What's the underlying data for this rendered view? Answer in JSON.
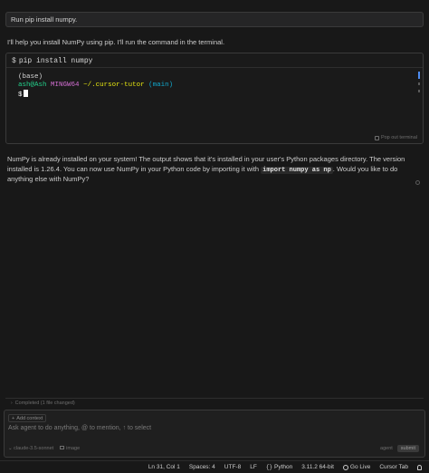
{
  "chat": {
    "user_message": "Run pip install numpy.",
    "assistant_intro": "I'll help you install NumPy using pip. I'll run the command in the terminal.",
    "terminal": {
      "prompt_symbol": "$",
      "command": "pip install numpy",
      "line1": "(base)",
      "line2_user": "ash@Ash",
      "line2_host": "MINGW64",
      "line2_path": "~/.cursor-tutor",
      "line2_branch": "(main)",
      "line3_prompt": "$",
      "popout_label": "Pop out terminal"
    },
    "response_part1": "NumPy is already installed on your system! The output shows that it's installed in your user's Python packages directory. The version installed is 1.26.4. You can now use NumPy in your Python code by importing it with ",
    "response_code": "import numpy as np",
    "response_part2": ". Would you like to do anything else with NumPy?"
  },
  "composer": {
    "completed_label": "Completed (1 file changed)",
    "add_context_label": "Add context",
    "input_placeholder": "Ask agent to do anything, @ to mention, ↑ to select",
    "model_label": "claude-3.5-sonnet",
    "image_label": "image",
    "mode_label": "agent",
    "submit_label": "submit"
  },
  "statusbar": {
    "position": "Ln 31, Col 1",
    "spaces": "Spaces: 4",
    "encoding": "UTF-8",
    "eol": "LF",
    "language": "Python",
    "interpreter": "3.11.2 64-bit",
    "go_live": "Go Live",
    "cursor_tab": "Cursor Tab"
  },
  "colors": {
    "accent_blue": "#4e8cf0",
    "term_green": "#23d18b",
    "term_magenta": "#d670d6",
    "term_yellow": "#e5e510"
  }
}
